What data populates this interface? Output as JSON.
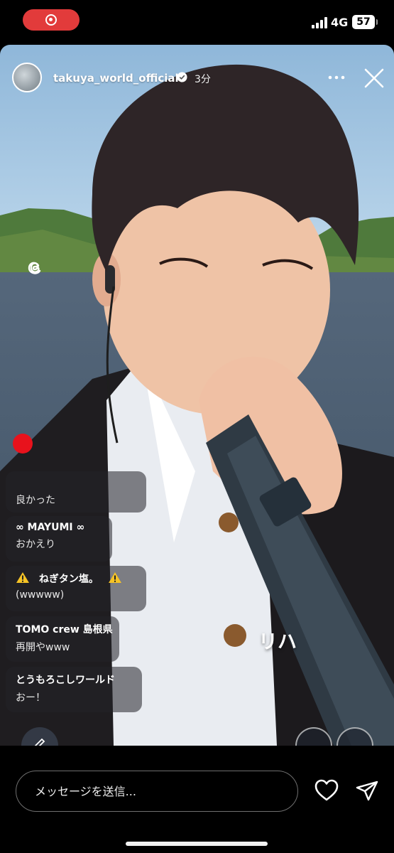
{
  "status_bar": {
    "network": "4G",
    "battery": "57"
  },
  "live": {
    "username": "takuya_world_official",
    "time_ago": "3分",
    "caption_overlay": "リハ"
  },
  "comments": [
    {
      "name": "",
      "message": "良かった"
    },
    {
      "name": "∞ MAYUMI ∞",
      "message": "おかえり"
    },
    {
      "name": "ねぎタン塩。",
      "message": "(wwwww)"
    },
    {
      "name": "TOMO crew 島根県",
      "message": "再開やwww"
    },
    {
      "name": "とうもろこしワールド",
      "message": "おー！"
    }
  ],
  "message_bar": {
    "placeholder": "メッセージを送信..."
  },
  "colors": {
    "record_pill": "#e23b3b",
    "live_dot": "#e8121c",
    "background": "#000000"
  }
}
